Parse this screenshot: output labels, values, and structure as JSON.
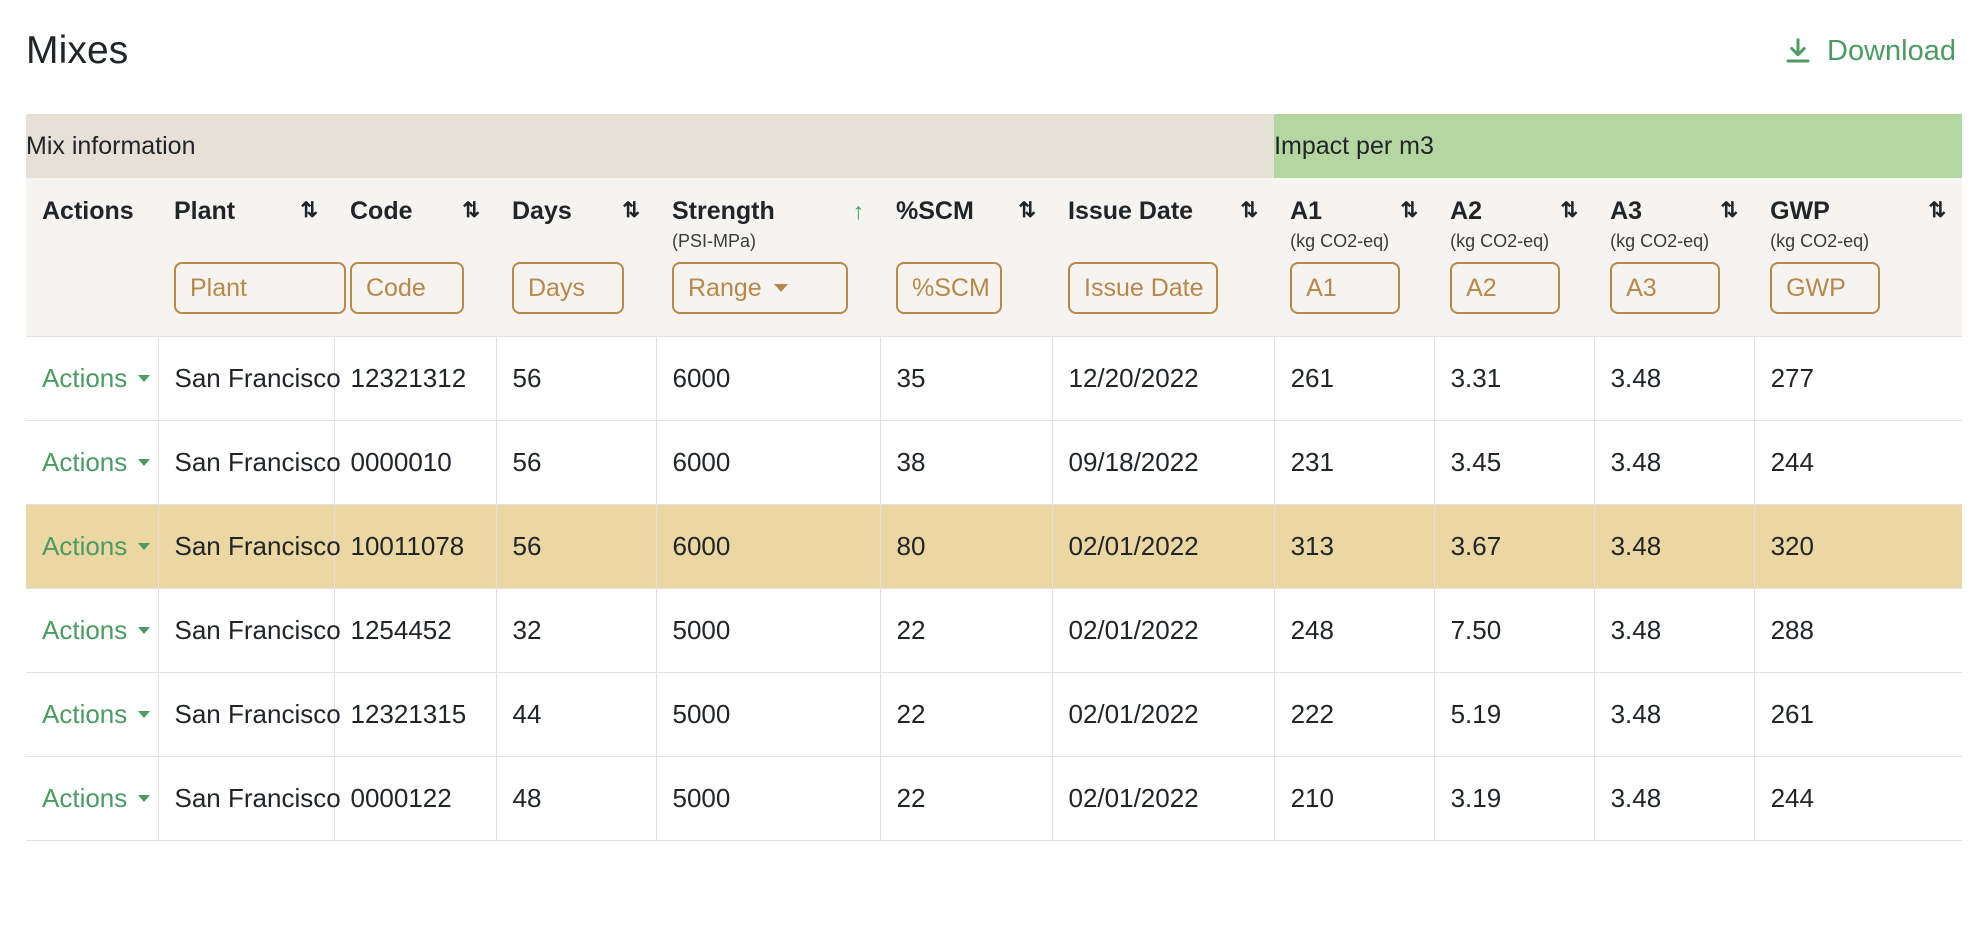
{
  "header": {
    "title": "Mixes",
    "download_label": "Download",
    "download_icon": "download-icon",
    "accent_green": "#4c9a64"
  },
  "colors": {
    "group_mix_bg": "#e7e0d6",
    "group_impact_bg": "#b4d6a0",
    "header_bg": "#f5f4f1",
    "highlight_row_bg": "#ead7a2",
    "filter_border": "#b8884a",
    "accent": "#4c9a64"
  },
  "table": {
    "group_headers": [
      {
        "label": "Mix information",
        "span": 7
      },
      {
        "label": "Impact per m3",
        "span": 4
      }
    ],
    "columns": [
      {
        "key": "actions",
        "label": "Actions",
        "sub": "",
        "sort": "none",
        "sort_icon": "",
        "filter": null
      },
      {
        "key": "plant",
        "label": "Plant",
        "sub": "",
        "sort": "idle",
        "sort_icon": "sort-both-icon",
        "filter": {
          "type": "text",
          "placeholder": "Plant",
          "value": "",
          "name": "filter-plant"
        }
      },
      {
        "key": "code",
        "label": "Code",
        "sub": "",
        "sort": "idle",
        "sort_icon": "sort-both-icon",
        "filter": {
          "type": "text",
          "placeholder": "Code",
          "value": "",
          "name": "filter-code"
        }
      },
      {
        "key": "days",
        "label": "Days",
        "sub": "",
        "sort": "idle",
        "sort_icon": "sort-both-icon",
        "filter": {
          "type": "text",
          "placeholder": "Days",
          "value": "",
          "name": "filter-days"
        }
      },
      {
        "key": "strength",
        "label": "Strength",
        "sub": "(PSI-MPa)",
        "sort": "asc",
        "sort_icon": "sort-asc-icon",
        "filter": {
          "type": "select",
          "placeholder": "Range",
          "value": "",
          "name": "filter-strength-range"
        }
      },
      {
        "key": "scm",
        "label": "%SCM",
        "sub": "",
        "sort": "idle",
        "sort_icon": "sort-both-icon",
        "filter": {
          "type": "text",
          "placeholder": "%SCM",
          "value": "",
          "name": "filter-scm"
        }
      },
      {
        "key": "issue",
        "label": "Issue Date",
        "sub": "",
        "sort": "idle",
        "sort_icon": "sort-both-icon",
        "filter": {
          "type": "text",
          "placeholder": "Issue Date",
          "value": "",
          "name": "filter-issue-date"
        }
      },
      {
        "key": "a1",
        "label": "A1",
        "sub": "(kg CO2-eq)",
        "sort": "idle",
        "sort_icon": "sort-both-icon",
        "filter": {
          "type": "text",
          "placeholder": "A1",
          "value": "",
          "name": "filter-a1"
        }
      },
      {
        "key": "a2",
        "label": "A2",
        "sub": "(kg CO2-eq)",
        "sort": "idle",
        "sort_icon": "sort-both-icon",
        "filter": {
          "type": "text",
          "placeholder": "A2",
          "value": "",
          "name": "filter-a2"
        }
      },
      {
        "key": "a3",
        "label": "A3",
        "sub": "(kg CO2-eq)",
        "sort": "idle",
        "sort_icon": "sort-both-icon",
        "filter": {
          "type": "text",
          "placeholder": "A3",
          "value": "",
          "name": "filter-a3"
        }
      },
      {
        "key": "gwp",
        "label": "GWP",
        "sub": "(kg CO2-eq)",
        "sort": "idle",
        "sort_icon": "sort-both-icon",
        "filter": {
          "type": "text",
          "placeholder": "GWP",
          "value": "",
          "name": "filter-gwp"
        }
      }
    ],
    "row_action_label": "Actions",
    "rows": [
      {
        "highlighted": false,
        "actions": "Actions",
        "plant": "San Francisco",
        "code": "12321312",
        "days": "56",
        "strength": "6000",
        "scm": "35",
        "issue": "12/20/2022",
        "a1": "261",
        "a2": "3.31",
        "a3": "3.48",
        "gwp": "277"
      },
      {
        "highlighted": false,
        "actions": "Actions",
        "plant": "San Francisco",
        "code": "0000010",
        "days": "56",
        "strength": "6000",
        "scm": "38",
        "issue": "09/18/2022",
        "a1": "231",
        "a2": "3.45",
        "a3": "3.48",
        "gwp": "244"
      },
      {
        "highlighted": true,
        "actions": "Actions",
        "plant": "San Francisco",
        "code": "10011078",
        "days": "56",
        "strength": "6000",
        "scm": "80",
        "issue": "02/01/2022",
        "a1": "313",
        "a2": "3.67",
        "a3": "3.48",
        "gwp": "320"
      },
      {
        "highlighted": false,
        "actions": "Actions",
        "plant": "San Francisco",
        "code": "1254452",
        "days": "32",
        "strength": "5000",
        "scm": "22",
        "issue": "02/01/2022",
        "a1": "248",
        "a2": "7.50",
        "a3": "3.48",
        "gwp": "288"
      },
      {
        "highlighted": false,
        "actions": "Actions",
        "plant": "San Francisco",
        "code": "12321315",
        "days": "44",
        "strength": "5000",
        "scm": "22",
        "issue": "02/01/2022",
        "a1": "222",
        "a2": "5.19",
        "a3": "3.48",
        "gwp": "261"
      },
      {
        "highlighted": false,
        "actions": "Actions",
        "plant": "San Francisco",
        "code": "0000122",
        "days": "48",
        "strength": "5000",
        "scm": "22",
        "issue": "02/01/2022",
        "a1": "210",
        "a2": "3.19",
        "a3": "3.48",
        "gwp": "244"
      }
    ]
  }
}
